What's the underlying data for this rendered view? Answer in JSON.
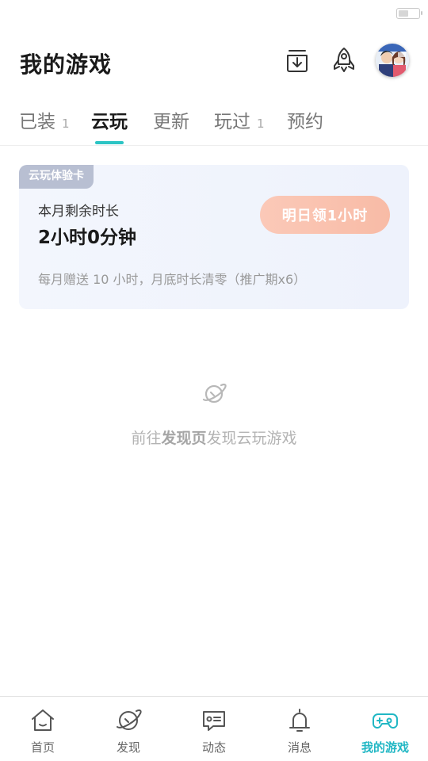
{
  "header": {
    "title": "我的游戏",
    "icons": [
      "download-icon",
      "rocket-icon",
      "avatar"
    ]
  },
  "tabs": [
    {
      "label": "已装",
      "count": "1",
      "active": false
    },
    {
      "label": "云玩",
      "count": "",
      "active": true
    },
    {
      "label": "更新",
      "count": "",
      "active": false
    },
    {
      "label": "玩过",
      "count": "1",
      "active": false
    },
    {
      "label": "预约",
      "count": "",
      "active": false
    }
  ],
  "cloud_card": {
    "tag": "云玩体验卡",
    "label": "本月剩余时长",
    "value": "2小时0分钟",
    "button": "明日领1小时",
    "note": "每月赠送 10 小时，月底时长清零（推广期x6）"
  },
  "empty_state": {
    "prefix": "前往",
    "link": "发现页",
    "suffix": "发现云玩游戏",
    "icon": "planet-icon"
  },
  "bottom_nav": [
    {
      "label": "首页",
      "icon": "home-icon",
      "active": false
    },
    {
      "label": "发现",
      "icon": "planet-icon",
      "active": false
    },
    {
      "label": "动态",
      "icon": "chat-icon",
      "active": false
    },
    {
      "label": "消息",
      "icon": "bell-icon",
      "active": false
    },
    {
      "label": "我的游戏",
      "icon": "gamepad-icon",
      "active": true
    }
  ],
  "colors": {
    "accent": "#21b7c4",
    "claim_button": "#f8bba6",
    "card_bg": "#f0f4fc",
    "tag_bg": "#b8bfd2"
  }
}
